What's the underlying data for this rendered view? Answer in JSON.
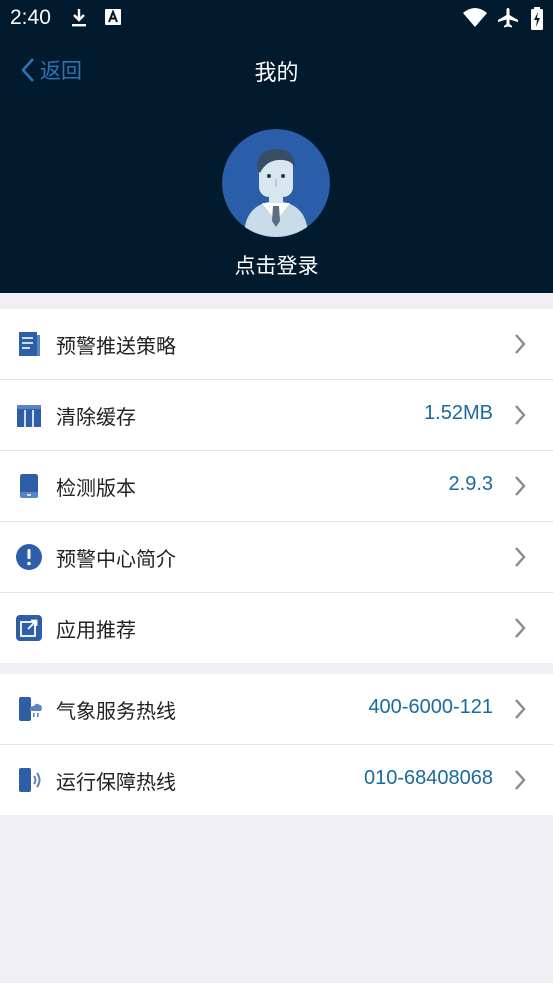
{
  "status_bar": {
    "time": "2:40"
  },
  "header": {
    "back_label": "返回",
    "title": "我的"
  },
  "profile": {
    "login_label": "点击登录"
  },
  "menu": [
    {
      "label": "预警推送策略",
      "value": ""
    },
    {
      "label": "清除缓存",
      "value": "1.52MB"
    },
    {
      "label": "检测版本",
      "value": "2.9.3"
    },
    {
      "label": "预警中心简介",
      "value": ""
    },
    {
      "label": "应用推荐",
      "value": ""
    }
  ],
  "hotlines": [
    {
      "label": "气象服务热线",
      "value": "400-6000-121"
    },
    {
      "label": "运行保障热线",
      "value": "010-68408068"
    }
  ],
  "colors": {
    "header_bg": "#011a2e",
    "accent": "#2d73b8",
    "value_text": "#1a6aa0",
    "page_bg": "#efeff4"
  }
}
